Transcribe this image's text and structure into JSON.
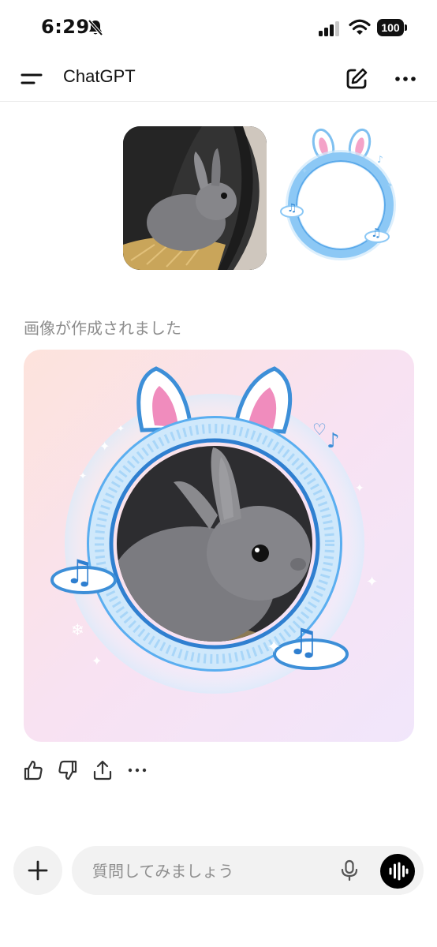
{
  "status_bar": {
    "time": "6:29",
    "battery": "100",
    "icons": [
      "bell-slash-icon",
      "cellular-signal-icon",
      "wifi-icon",
      "battery-icon"
    ]
  },
  "header": {
    "title": "ChatGPT",
    "icons": [
      "menu-icon",
      "new-chat-icon",
      "more-icon"
    ]
  },
  "user_message": {
    "attachments": [
      "rabbit-photo",
      "bunny-frame-image"
    ]
  },
  "assistant_message": {
    "status_text": "画像が作成されました",
    "image": "generated-bunny-frame-image"
  },
  "actions": {
    "icons": [
      "thumbs-up-icon",
      "thumbs-down-icon",
      "share-icon",
      "more-icon"
    ]
  },
  "composer": {
    "placeholder": "質問してみましょう",
    "icons": [
      "plus-icon",
      "microphone-icon",
      "voice-mode-icon"
    ]
  },
  "colors": {
    "frame_blue": "#8cc8f5",
    "frame_blue_dark": "#3d8fd8",
    "ear_pink": "#f4a3c8",
    "card_bg_start": "#fde3dc",
    "card_bg_end": "#f1e6fb",
    "input_bg": "#f2f2f2"
  }
}
